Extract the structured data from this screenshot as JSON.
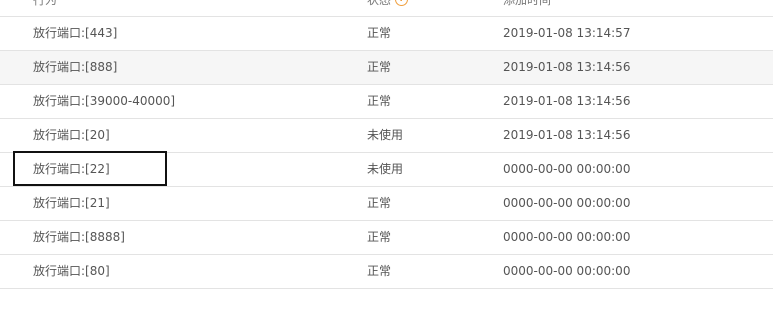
{
  "table": {
    "columns": {
      "action": "行为",
      "status": "状态",
      "time": "添加时间"
    },
    "status_help_icon": "help-circle-icon",
    "rows": [
      {
        "action": "放行端口:[443]",
        "status": "正常",
        "time": "2019-01-08 13:14:57"
      },
      {
        "action": "放行端口:[888]",
        "status": "正常",
        "time": "2019-01-08 13:14:56"
      },
      {
        "action": "放行端口:[39000-40000]",
        "status": "正常",
        "time": "2019-01-08 13:14:56"
      },
      {
        "action": "放行端口:[20]",
        "status": "未使用",
        "time": "2019-01-08 13:14:56"
      },
      {
        "action": "放行端口:[22]",
        "status": "未使用",
        "time": "0000-00-00 00:00:00"
      },
      {
        "action": "放行端口:[21]",
        "status": "正常",
        "time": "0000-00-00 00:00:00"
      },
      {
        "action": "放行端口:[8888]",
        "status": "正常",
        "time": "0000-00-00 00:00:00"
      },
      {
        "action": "放行端口:[80]",
        "status": "正常",
        "time": "0000-00-00 00:00:00"
      }
    ]
  },
  "colors": {
    "help_icon": "#f0a040",
    "highlight_border": "#111111",
    "row_alt_bg": "#f6f6f6"
  }
}
